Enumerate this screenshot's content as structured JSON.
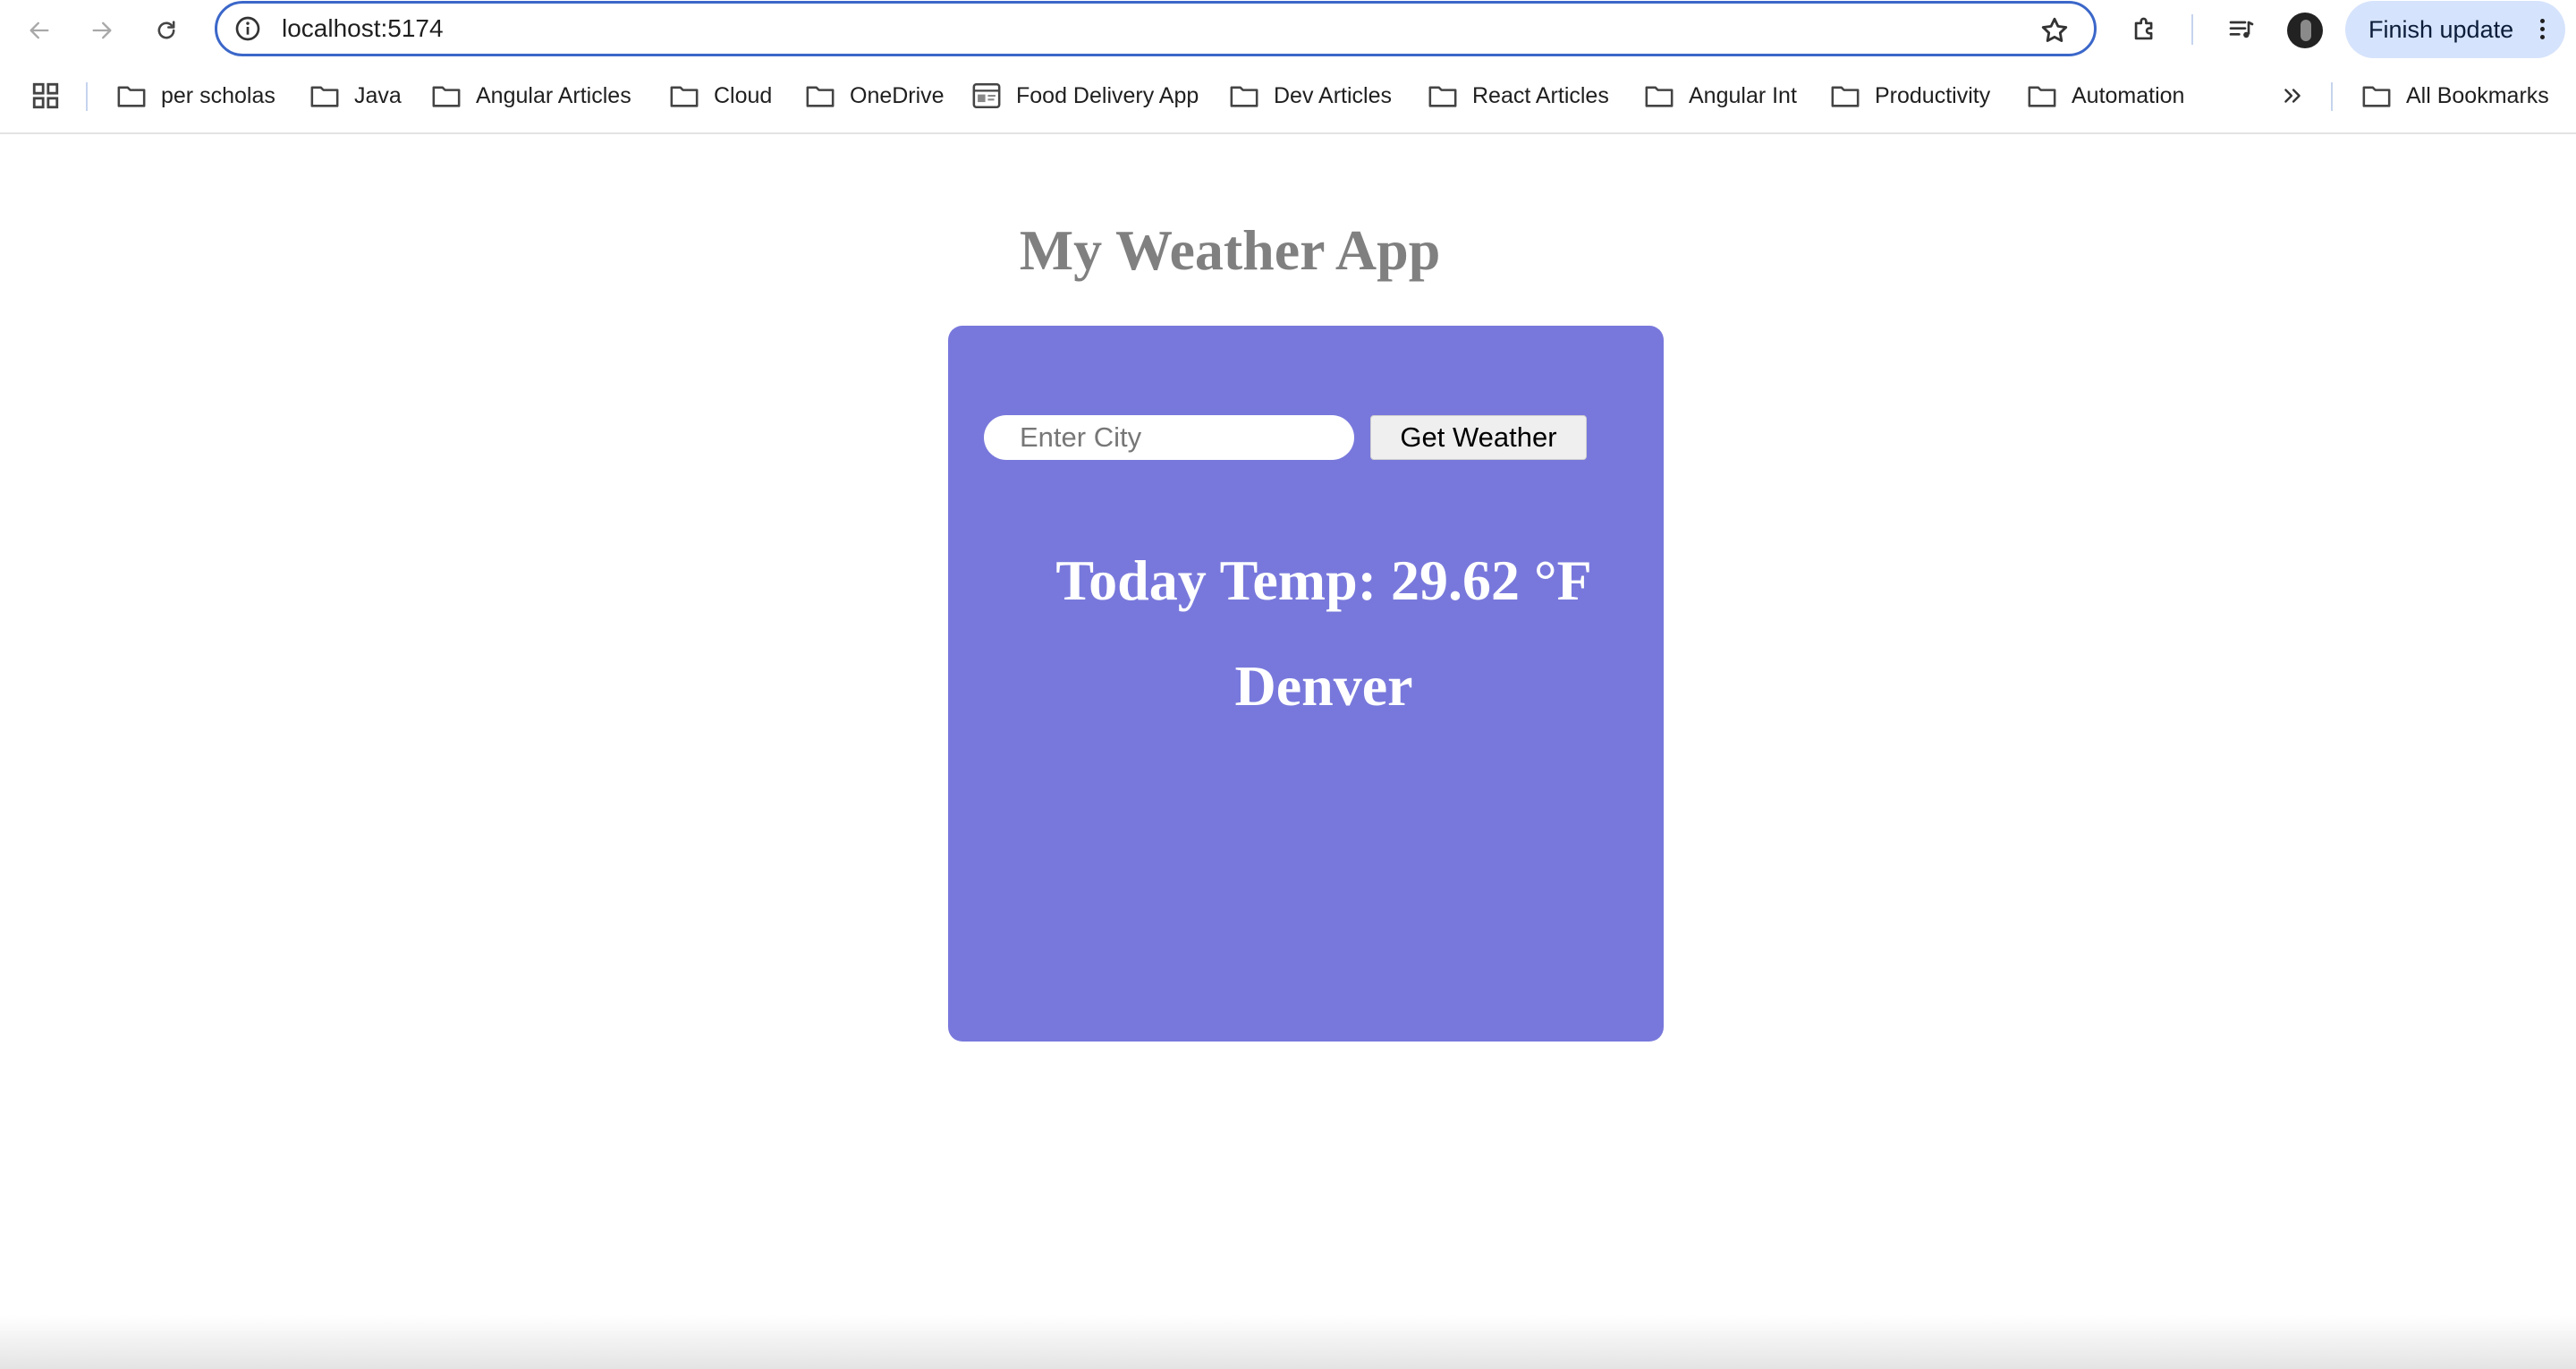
{
  "browser": {
    "url": "localhost:5174",
    "update_label": "Finish update",
    "icons": {
      "back": "back-arrow-icon",
      "forward": "forward-arrow-icon",
      "reload": "reload-icon",
      "site_info": "info-icon",
      "star": "star-icon",
      "extensions": "puzzle-icon",
      "media": "media-queue-icon",
      "menu": "vertical-dots-icon"
    },
    "accent": "#3b67c9"
  },
  "bookmarks": {
    "items": [
      {
        "label": "per scholas",
        "icon": "folder-icon"
      },
      {
        "label": "Java",
        "icon": "folder-icon"
      },
      {
        "label": "Angular Articles",
        "icon": "folder-icon"
      },
      {
        "label": "Cloud",
        "icon": "folder-icon"
      },
      {
        "label": "OneDrive",
        "icon": "folder-icon"
      },
      {
        "label": "Food Delivery App",
        "icon": "page-icon"
      },
      {
        "label": "Dev Articles",
        "icon": "folder-icon"
      },
      {
        "label": "React Articles",
        "icon": "folder-icon"
      },
      {
        "label": "Angular Int",
        "icon": "folder-icon"
      },
      {
        "label": "Productivity",
        "icon": "folder-icon"
      },
      {
        "label": "Automation",
        "icon": "folder-icon"
      }
    ],
    "all_bookmarks": "All Bookmarks"
  },
  "app": {
    "title": "My Weather App",
    "search": {
      "placeholder": "Enter City",
      "value": ""
    },
    "button_label": "Get Weather",
    "temperature": "Today Temp: 29.62 °F",
    "city": "Denver",
    "card_color": "#7878dc"
  }
}
